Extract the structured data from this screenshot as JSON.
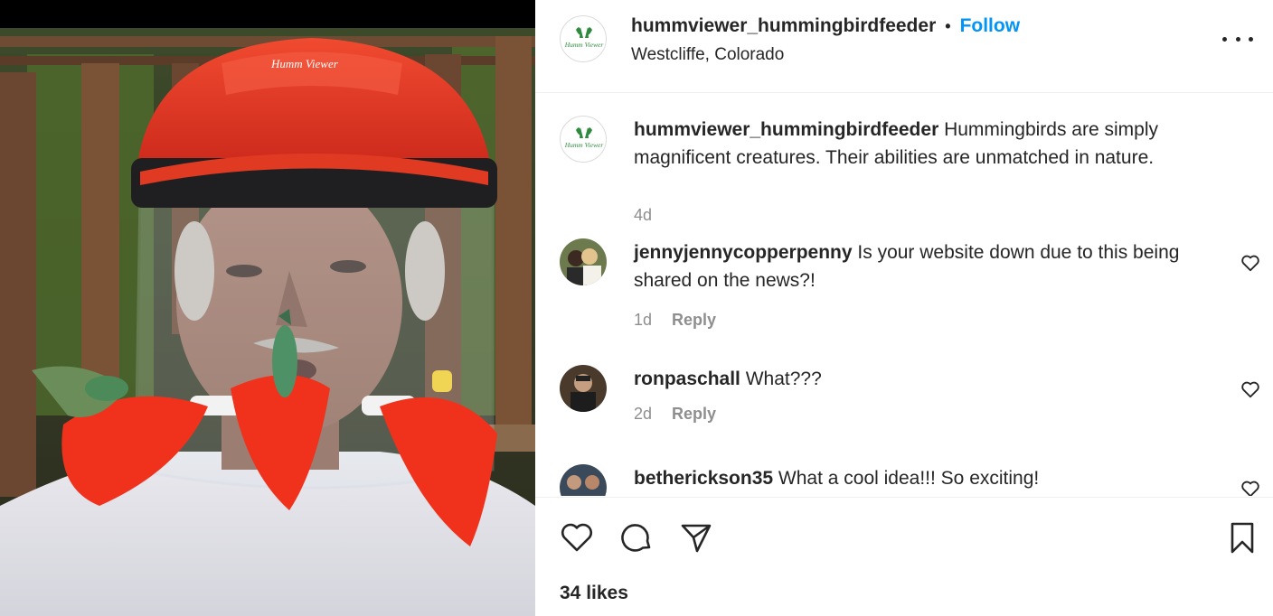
{
  "post": {
    "username": "hummviewer_hummingbirdfeeder",
    "separator": "•",
    "follow_label": "Follow",
    "location": "Westcliffe, Colorado",
    "more_icon": "more-options-icon",
    "logo_text": "Humm Viewer",
    "helmet_text": "Humm Viewer"
  },
  "caption": {
    "username": "hummviewer_hummingbirdfeeder",
    "text": " Hummingbirds are simply magnificent creatures. Their abilities are unmatched in nature.",
    "time": "4d"
  },
  "comments": [
    {
      "username": "jennyjennycopperpenny",
      "text": " Is your website down due to this being shared on the news?!",
      "time": "1d",
      "reply_label": "Reply"
    },
    {
      "username": "ronpaschall",
      "text": " What???",
      "time": "2d",
      "reply_label": "Reply"
    },
    {
      "username": "beth​erickson35",
      "text": " What a cool idea!!! So exciting!"
    }
  ],
  "actions": {
    "like_icon": "heart-icon",
    "comment_icon": "comment-icon",
    "share_icon": "share-icon",
    "save_icon": "bookmark-icon",
    "likes": "34 likes"
  },
  "colors": {
    "follow": "#0095f6",
    "text": "#262626",
    "muted": "#8e8e8e",
    "helmet": "#e8321e",
    "flower": "#f0321c"
  }
}
